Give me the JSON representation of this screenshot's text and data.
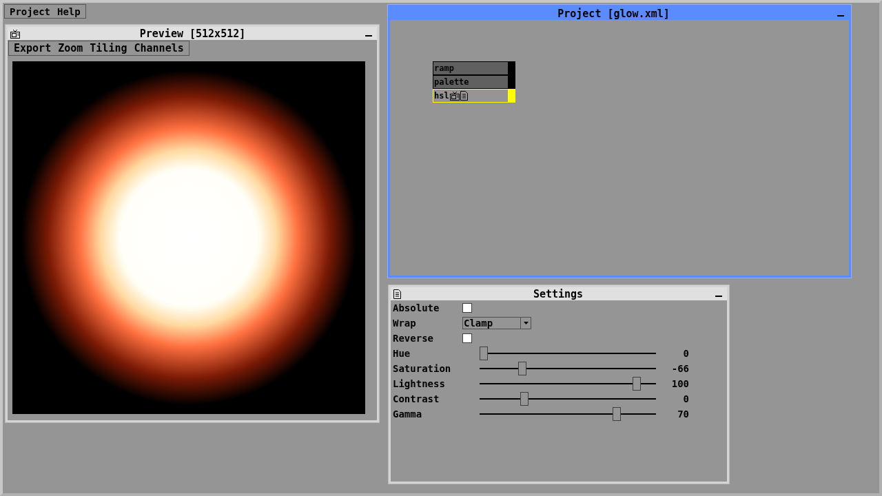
{
  "menu_bar": [
    {
      "label": "Project"
    },
    {
      "label": "Help"
    }
  ],
  "preview_window": {
    "title": "Preview [512x512]",
    "menu": [
      {
        "label": "Export"
      },
      {
        "label": "Zoom"
      },
      {
        "label": "Tiling"
      },
      {
        "label": "Channels"
      }
    ]
  },
  "project_window": {
    "title": "Project [glow.xml]",
    "focused": true,
    "nodes": [
      {
        "label": "ramp",
        "kind": "plain",
        "selected": false
      },
      {
        "label": "palette",
        "kind": "plain",
        "selected": false
      },
      {
        "label": "hsl",
        "kind": "with-icons",
        "selected": true
      }
    ]
  },
  "settings_window": {
    "title": "Settings",
    "fields": [
      {
        "kind": "checkbox",
        "label": "Absolute",
        "checked": false
      },
      {
        "kind": "dropdown",
        "label": "Wrap",
        "value": "Clamp"
      },
      {
        "kind": "checkbox",
        "label": "Reverse",
        "checked": false
      },
      {
        "kind": "slider",
        "label": "Hue",
        "level": 0,
        "reading": "0"
      },
      {
        "kind": "slider",
        "label": "Saturation",
        "level": 0.23,
        "reading": "-66"
      },
      {
        "kind": "slider",
        "label": "Lightness",
        "level": 0.91,
        "reading": "100"
      },
      {
        "kind": "slider",
        "label": "Contrast",
        "level": 0.24,
        "reading": "0"
      },
      {
        "kind": "slider",
        "label": "Gamma",
        "level": 0.79,
        "reading": "70"
      }
    ]
  }
}
